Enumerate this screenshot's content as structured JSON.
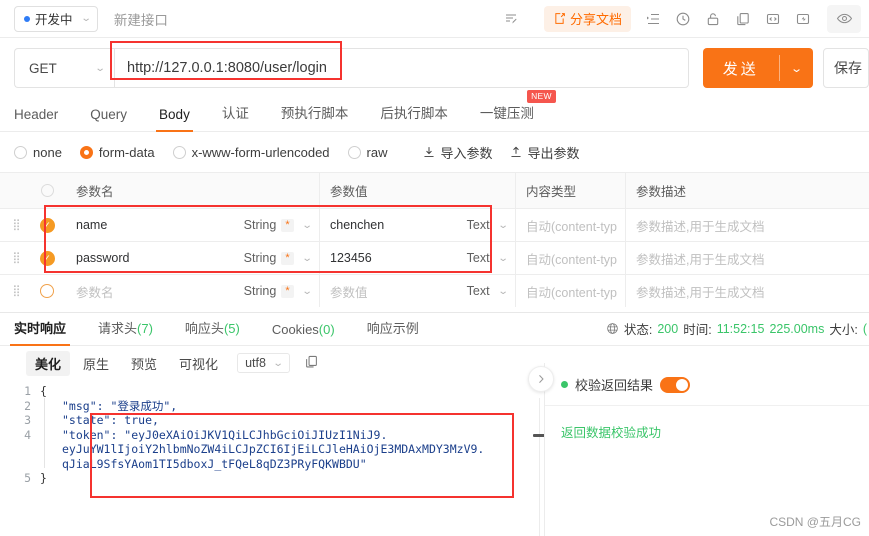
{
  "topbar": {
    "status_label": "开发中",
    "api_name": "新建接口",
    "share_label": "分享文档",
    "icons": [
      "edit-note-icon",
      "share-doc-icon",
      "indent-list-icon",
      "history-clock-icon",
      "unlock-icon",
      "copy-icon",
      "code-brackets-icon",
      "export-icon",
      "eye-icon"
    ]
  },
  "request": {
    "method": "GET",
    "url": "http://127.0.0.1:8080/user/login",
    "send_label": "发送",
    "save_label": "保存"
  },
  "tabs": [
    {
      "label": "Header",
      "active": false
    },
    {
      "label": "Query",
      "active": false
    },
    {
      "label": "Body",
      "active": true
    },
    {
      "label": "认证",
      "active": false
    },
    {
      "label": "预执行脚本",
      "active": false
    },
    {
      "label": "后执行脚本",
      "active": false
    },
    {
      "label": "一键压测",
      "active": false,
      "badge": "NEW"
    }
  ],
  "body_types": [
    {
      "label": "none",
      "selected": false
    },
    {
      "label": "form-data",
      "selected": true
    },
    {
      "label": "x-www-form-urlencoded",
      "selected": false
    },
    {
      "label": "raw",
      "selected": false
    }
  ],
  "body_actions": [
    {
      "label": "导入参数",
      "icon": "import-icon"
    },
    {
      "label": "导出参数",
      "icon": "export-up-icon"
    }
  ],
  "params_table": {
    "headers": [
      "参数名",
      "参数值",
      "内容类型",
      "参数描述"
    ],
    "rows": [
      {
        "checked": true,
        "name": "name",
        "name_type": "String",
        "required": "*",
        "value": "chenchen",
        "value_type": "Text",
        "content_type": "自动(content-typ",
        "description_placeholder": "参数描述,用于生成文档",
        "highlighted": true
      },
      {
        "checked": true,
        "name": "password",
        "name_type": "String",
        "required": "*",
        "value": "123456",
        "value_type": "Text",
        "content_type": "自动(content-typ",
        "description_placeholder": "参数描述,用于生成文档",
        "highlighted": true
      },
      {
        "checked": false,
        "name": "",
        "name_placeholder": "参数名",
        "name_type": "String",
        "required": "*",
        "value": "",
        "value_placeholder": "参数值",
        "value_type": "Text",
        "content_type": "自动(content-typ",
        "description_placeholder": "参数描述,用于生成文档",
        "highlighted": false
      }
    ]
  },
  "response": {
    "tabs": [
      {
        "label": "实时响应",
        "count": "",
        "active": true
      },
      {
        "label": "请求头",
        "count": "(7)",
        "active": false
      },
      {
        "label": "响应头",
        "count": "(5)",
        "active": false
      },
      {
        "label": "Cookies",
        "count": "(0)",
        "active": false
      },
      {
        "label": "响应示例",
        "count": "",
        "active": false
      }
    ],
    "status": {
      "globe_icon": "globe-icon",
      "status_label": "状态:",
      "status_value": "200",
      "time_label": "时间:",
      "time_value": "11:52:15",
      "duration_value": "225.00ms",
      "size_label": "大小:",
      "size_value": "("
    },
    "viewer_tabs": [
      {
        "label": "美化",
        "active": true
      },
      {
        "label": "原生",
        "active": false
      },
      {
        "label": "预览",
        "active": false
      },
      {
        "label": "可视化",
        "active": false
      }
    ],
    "encoding": "utf8",
    "copy_icon": "copy-icon",
    "code_lines": [
      {
        "num": "1",
        "text": "{",
        "indent": false
      },
      {
        "num": "2",
        "text": "\"msg\": \"登录成功\",",
        "indent": true
      },
      {
        "num": "3",
        "text": "\"state\": true,",
        "indent": true
      },
      {
        "num": "4",
        "text": "\"token\": \"eyJ0eXAiOiJKV1QiLCJhbGciOiJIUzI1NiJ9.",
        "indent": true
      },
      {
        "num": "",
        "text": "eyJuYW1lIjoiY2hlbmNoZW4iLCJpZCI6IjEiLCJleHAiOjE3MDAxMDY3MzV9.",
        "indent": true
      },
      {
        "num": "",
        "text": "qJiaL9SfsYAom1TI5dboxJ_tFQeL8qDZ3PRyFQKWBDU\"",
        "indent": true
      },
      {
        "num": "5",
        "text": "}",
        "indent": false
      }
    ]
  },
  "validation": {
    "title": "校验返回结果",
    "toggle_on": true,
    "message": "返回数据校验成功"
  },
  "watermark": "CSDN @五月CG",
  "colors": {
    "accent": "#f97316",
    "success": "#3ac569",
    "annotation": "#f5332f",
    "code": "#1b3f8b"
  }
}
